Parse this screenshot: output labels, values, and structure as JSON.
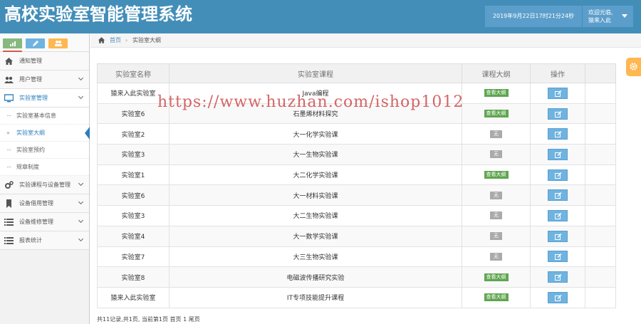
{
  "header": {
    "title": "高校实验室智能管理系统",
    "datetime": "2019年9月22日17时21分24秒",
    "welcome": "欢迎光临,",
    "username": "猿来入此",
    "bg_color": "#438eb9"
  },
  "sidebar": {
    "shortcuts": [
      {
        "icon": "signal-icon",
        "color": "#87b87f"
      },
      {
        "icon": "pencil-icon",
        "color": "#6fb3e0"
      },
      {
        "icon": "users-icon",
        "color": "#ffb752"
      },
      {
        "icon": "cogs-icon",
        "color": "#d15b47"
      }
    ],
    "menu": [
      {
        "label": "通知管理",
        "icon": "home-icon"
      },
      {
        "label": "用户管理",
        "icon": "users-icon"
      },
      {
        "label": "实验室管理",
        "icon": "desktop-icon"
      },
      {
        "label": "实验课程与设备管理",
        "icon": "cogs-icon"
      },
      {
        "label": "设备借用管理",
        "icon": "bookmark-icon"
      },
      {
        "label": "设备维修管理",
        "icon": "list-icon"
      },
      {
        "label": "报表统计",
        "icon": "list-icon"
      }
    ],
    "submenu": [
      {
        "label": "实验室基本信息"
      },
      {
        "label": "实验室大纲"
      },
      {
        "label": "实验室预约"
      },
      {
        "label": "规章制度"
      }
    ]
  },
  "breadcrumb": {
    "home": "首页",
    "separator": "›",
    "current": "实验室大纲"
  },
  "table": {
    "headers": [
      "实验室名称",
      "实验室课程",
      "课程大纲",
      "操作",
      ""
    ],
    "rows": [
      {
        "lab": "猿来入此实验室",
        "course": "Java编程",
        "syllabus": "查看大纲"
      },
      {
        "lab": "实验室6",
        "course": "石墨烯材料探究",
        "syllabus": "查看大纲"
      },
      {
        "lab": "实验室2",
        "course": "大一化学实验课",
        "syllabus": "无"
      },
      {
        "lab": "实验室3",
        "course": "大一生物实验课",
        "syllabus": "无"
      },
      {
        "lab": "实验室1",
        "course": "大二化学实验课",
        "syllabus": "查看大纲"
      },
      {
        "lab": "实验室6",
        "course": "大一材料实验课",
        "syllabus": "无"
      },
      {
        "lab": "实验室3",
        "course": "大二生物实验课",
        "syllabus": "无"
      },
      {
        "lab": "实验室4",
        "course": "大一数学实验课",
        "syllabus": "无"
      },
      {
        "lab": "实验室7",
        "course": "大三生物实验课",
        "syllabus": "无"
      },
      {
        "lab": "实验室8",
        "course": "电磁波传播研究实验",
        "syllabus": "查看大纲"
      },
      {
        "lab": "猿来入此实验室",
        "course": "IT专项技能提升课程",
        "syllabus": "查看大纲"
      }
    ]
  },
  "pagination": "共11记录,共1页, 当前第1页 首页 1 尾页",
  "watermark": "https://www.huzhan.com/ishop1012"
}
